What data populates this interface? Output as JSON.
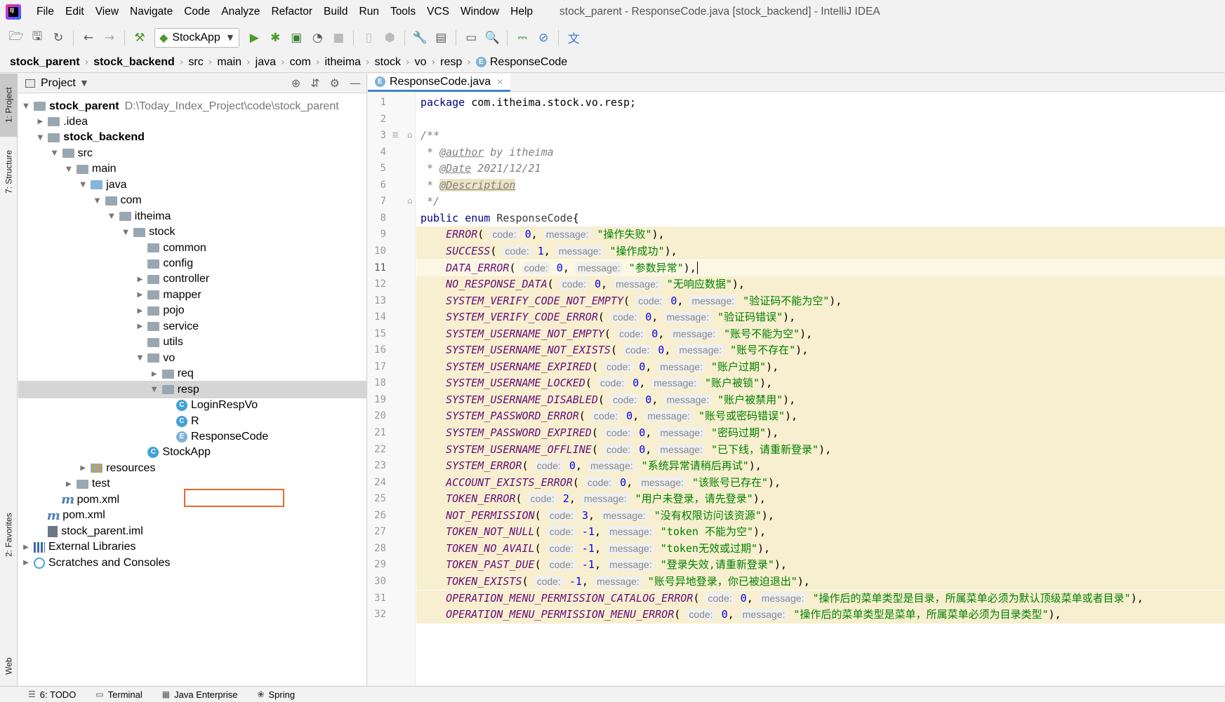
{
  "window_title": "stock_parent - ResponseCode.java [stock_backend] - IntelliJ IDEA",
  "menu": [
    "File",
    "Edit",
    "View",
    "Navigate",
    "Code",
    "Analyze",
    "Refactor",
    "Build",
    "Run",
    "Tools",
    "VCS",
    "Window",
    "Help"
  ],
  "toolbar": {
    "run_config": "StockApp",
    "icons": [
      "open-icon",
      "save-icon",
      "sync-icon",
      "back-icon",
      "forward-icon",
      "build-hammer-icon",
      "run-icon",
      "debug-icon",
      "coverage-icon",
      "profile-icon",
      "stop-icon",
      "device-icon",
      "settings-wrench-icon",
      "project-structure-icon",
      "terminal-icon",
      "search-icon",
      "activity-icon",
      "no-entry-icon",
      "translate-icon"
    ]
  },
  "breadcrumb": [
    "stock_parent",
    "stock_backend",
    "src",
    "main",
    "java",
    "com",
    "itheima",
    "stock",
    "vo",
    "resp",
    "ResponseCode"
  ],
  "left_stripe": {
    "project": "1: Project",
    "structure": "7: Structure",
    "favorites": "2: Favorites",
    "web": "Web"
  },
  "project_panel": {
    "title": "Project",
    "tree": [
      {
        "label": "stock_parent",
        "path": "D:\\Today_Index_Project\\code\\stock_parent",
        "depth": 0,
        "arrow": "open",
        "icon": "module",
        "bold": true
      },
      {
        "label": ".idea",
        "depth": 1,
        "arrow": "closed",
        "icon": "folder"
      },
      {
        "label": "stock_backend",
        "depth": 1,
        "arrow": "open",
        "icon": "module",
        "bold": true
      },
      {
        "label": "src",
        "depth": 2,
        "arrow": "open",
        "icon": "folder"
      },
      {
        "label": "main",
        "depth": 3,
        "arrow": "open",
        "icon": "folder"
      },
      {
        "label": "java",
        "depth": 4,
        "arrow": "open",
        "icon": "folder-blue"
      },
      {
        "label": "com",
        "depth": 5,
        "arrow": "open",
        "icon": "package"
      },
      {
        "label": "itheima",
        "depth": 6,
        "arrow": "open",
        "icon": "package"
      },
      {
        "label": "stock",
        "depth": 7,
        "arrow": "open",
        "icon": "package"
      },
      {
        "label": "common",
        "depth": 8,
        "arrow": "none",
        "icon": "package"
      },
      {
        "label": "config",
        "depth": 8,
        "arrow": "none",
        "icon": "package"
      },
      {
        "label": "controller",
        "depth": 8,
        "arrow": "closed",
        "icon": "package"
      },
      {
        "label": "mapper",
        "depth": 8,
        "arrow": "closed",
        "icon": "package"
      },
      {
        "label": "pojo",
        "depth": 8,
        "arrow": "closed",
        "icon": "package"
      },
      {
        "label": "service",
        "depth": 8,
        "arrow": "closed",
        "icon": "package"
      },
      {
        "label": "utils",
        "depth": 8,
        "arrow": "none",
        "icon": "package"
      },
      {
        "label": "vo",
        "depth": 8,
        "arrow": "open",
        "icon": "package"
      },
      {
        "label": "req",
        "depth": 9,
        "arrow": "closed",
        "icon": "package"
      },
      {
        "label": "resp",
        "depth": 9,
        "arrow": "open",
        "icon": "package",
        "selected": true
      },
      {
        "label": "LoginRespVo",
        "depth": 10,
        "arrow": "none",
        "icon": "class"
      },
      {
        "label": "R",
        "depth": 10,
        "arrow": "none",
        "icon": "class"
      },
      {
        "label": "ResponseCode",
        "depth": 10,
        "arrow": "none",
        "icon": "enum"
      },
      {
        "label": "StockApp",
        "depth": 8,
        "arrow": "none",
        "icon": "class-spring"
      },
      {
        "label": "resources",
        "depth": 4,
        "arrow": "closed",
        "icon": "folder-res"
      },
      {
        "label": "test",
        "depth": 3,
        "arrow": "closed",
        "icon": "folder"
      },
      {
        "label": "pom.xml",
        "depth": 2,
        "arrow": "none",
        "icon": "maven"
      },
      {
        "label": "pom.xml",
        "depth": 1,
        "arrow": "none",
        "icon": "maven"
      },
      {
        "label": "stock_parent.iml",
        "depth": 1,
        "arrow": "none",
        "icon": "iml"
      },
      {
        "label": "External Libraries",
        "depth": 0,
        "arrow": "closed",
        "icon": "library"
      },
      {
        "label": "Scratches and Consoles",
        "depth": 0,
        "arrow": "closed",
        "icon": "scratch"
      }
    ]
  },
  "editor": {
    "tab_label": "ResponseCode.java",
    "current_line": 11,
    "package_line": "com.itheima.stock.vo.resp;",
    "javadoc": {
      "author_tag": "@author",
      "author": " by itheima",
      "date_tag": "@Date",
      "date": " 2021/12/21",
      "desc_tag": "@Description"
    },
    "enum_name": "ResponseCode",
    "constants": [
      {
        "name": "ERROR",
        "code": "0",
        "message": "\"操作失败\""
      },
      {
        "name": "SUCCESS",
        "code": "1",
        "message": "\"操作成功\""
      },
      {
        "name": "DATA_ERROR",
        "code": "0",
        "message": "\"参数异常\""
      },
      {
        "name": "NO_RESPONSE_DATA",
        "code": "0",
        "message": "\"无响应数据\""
      },
      {
        "name": "SYSTEM_VERIFY_CODE_NOT_EMPTY",
        "code": "0",
        "message": "\"验证码不能为空\""
      },
      {
        "name": "SYSTEM_VERIFY_CODE_ERROR",
        "code": "0",
        "message": "\"验证码错误\""
      },
      {
        "name": "SYSTEM_USERNAME_NOT_EMPTY",
        "code": "0",
        "message": "\"账号不能为空\""
      },
      {
        "name": "SYSTEM_USERNAME_NOT_EXISTS",
        "code": "0",
        "message": "\"账号不存在\""
      },
      {
        "name": "SYSTEM_USERNAME_EXPIRED",
        "code": "0",
        "message": "\"账户过期\""
      },
      {
        "name": "SYSTEM_USERNAME_LOCKED",
        "code": "0",
        "message": "\"账户被锁\""
      },
      {
        "name": "SYSTEM_USERNAME_DISABLED",
        "code": "0",
        "message": "\"账户被禁用\""
      },
      {
        "name": "SYSTEM_PASSWORD_ERROR",
        "code": "0",
        "message": "\"账号或密码错误\""
      },
      {
        "name": "SYSTEM_PASSWORD_EXPIRED",
        "code": "0",
        "message": "\"密码过期\""
      },
      {
        "name": "SYSTEM_USERNAME_OFFLINE",
        "code": "0",
        "message": "\"已下线，请重新登录\""
      },
      {
        "name": "SYSTEM_ERROR",
        "code": "0",
        "message": "\"系统异常请稍后再试\""
      },
      {
        "name": "ACCOUNT_EXISTS_ERROR",
        "code": "0",
        "message": "\"该账号已存在\""
      },
      {
        "name": "TOKEN_ERROR",
        "code": "2",
        "message": "\"用户未登录，请先登录\""
      },
      {
        "name": "NOT_PERMISSION",
        "code": "3",
        "message": "\"没有权限访问该资源\""
      },
      {
        "name": "TOKEN_NOT_NULL",
        "code": "-1",
        "message": "\"token 不能为空\""
      },
      {
        "name": "TOKEN_NO_AVAIL",
        "code": "-1",
        "message": "\"token无效或过期\""
      },
      {
        "name": "TOKEN_PAST_DUE",
        "code": "-1",
        "message": "\"登录失效,请重新登录\""
      },
      {
        "name": "TOKEN_EXISTS",
        "code": "-1",
        "message": "\"账号异地登录，你已被迫退出\""
      },
      {
        "name": "OPERATION_MENU_PERMISSION_CATALOG_ERROR",
        "code": "0",
        "message": "\"操作后的菜单类型是目录，所属菜单必须为默认顶级菜单或者目录\""
      },
      {
        "name": "OPERATION_MENU_PERMISSION_MENU_ERROR",
        "code": "0",
        "message": "\"操作后的菜单类型是菜单，所属菜单必须为目录类型\""
      }
    ],
    "hint_code": "code:",
    "hint_message": "message:"
  },
  "bottom_tabs": [
    "6: TODO",
    "Terminal",
    "Java Enterprise",
    "Spring"
  ]
}
